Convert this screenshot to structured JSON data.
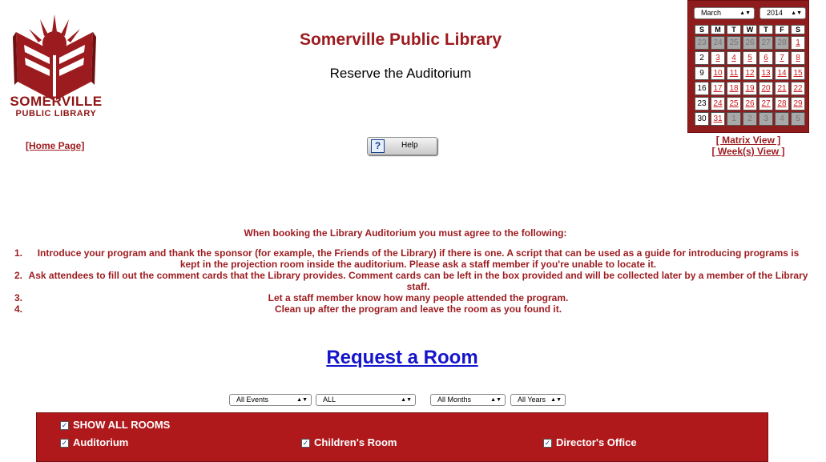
{
  "logo": {
    "name": "SOMERVILLE",
    "subtitle": "PUBLIC LIBRARY"
  },
  "header": {
    "site_title": "Somerville Public Library",
    "page_title": "Reserve the Auditorium"
  },
  "nav": {
    "home": "[Home Page]",
    "help": "Help"
  },
  "calendar": {
    "month": "March",
    "year": "2014",
    "weekdays": [
      "S",
      "M",
      "T",
      "W",
      "T",
      "F",
      "S"
    ],
    "weeks": [
      [
        "23",
        "24",
        "25",
        "26",
        "27",
        "28",
        "1"
      ],
      [
        "2",
        "3",
        "4",
        "5",
        "6",
        "7",
        "8"
      ],
      [
        "9",
        "10",
        "11",
        "12",
        "13",
        "14",
        "15"
      ],
      [
        "16",
        "17",
        "18",
        "19",
        "20",
        "21",
        "22"
      ],
      [
        "23",
        "24",
        "25",
        "26",
        "27",
        "28",
        "29"
      ],
      [
        "30",
        "31",
        "1",
        "2",
        "3",
        "4",
        "5"
      ]
    ],
    "matrix_view": "[ Matrix View ]",
    "weeks_view": "[ Week(s) View ]"
  },
  "rules": {
    "heading": "When booking the Library Auditorium you must agree to the following:",
    "items": [
      {
        "num": "1.",
        "text": "Introduce your program and thank the sponsor (for example, the Friends of the Library) if there is one. A script that can be used as a guide for introducing programs is kept in the projection room inside the auditorium. Please ask a staff member if you're unable to locate it."
      },
      {
        "num": "2.",
        "text": "Ask attendees to fill out the comment cards that the Library provides. Comment cards can be left in the box provided and will be collected later by a member of the Library staff."
      },
      {
        "num": "3.",
        "text": "Let a staff member know how many people attended the program."
      },
      {
        "num": "4.",
        "text": "Clean up after the program and leave the room as you found it."
      }
    ]
  },
  "request": {
    "label": "Request a Room"
  },
  "filters": {
    "events": "All Events",
    "category": "ALL",
    "months": "All Months",
    "years": "All Years"
  },
  "rooms": {
    "show_all": "SHOW ALL ROOMS",
    "auditorium": "Auditorium",
    "childrens": "Children's Room",
    "director": "Director's Office"
  },
  "colors": {
    "brand_red": "#9c1b1f",
    "link_blue": "#1515cc",
    "panel_red": "#b0191c"
  }
}
